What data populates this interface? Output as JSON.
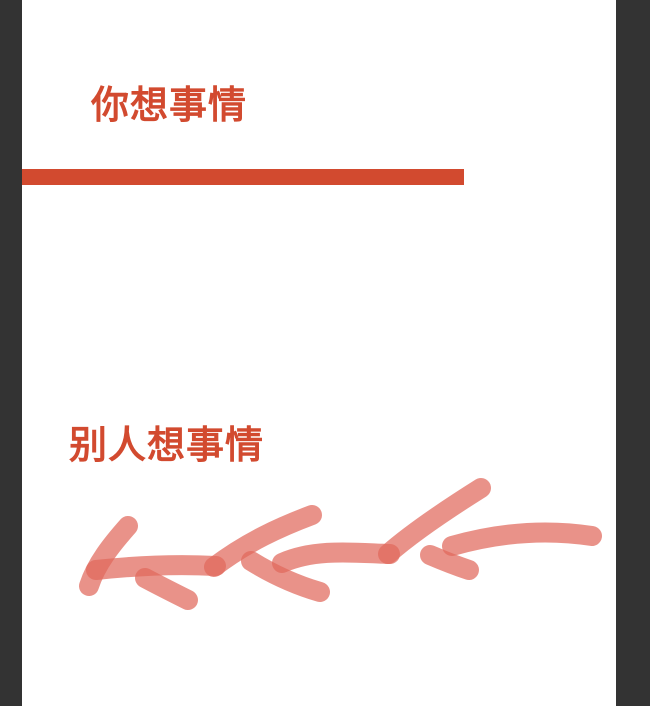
{
  "slide": {
    "top_heading": "你想事情",
    "bottom_heading": "别人想事情"
  },
  "colors": {
    "accent": "#d24a2f",
    "scribble": "#e0685c",
    "side_margin": "#333333",
    "slide_background": "#ffffff"
  }
}
